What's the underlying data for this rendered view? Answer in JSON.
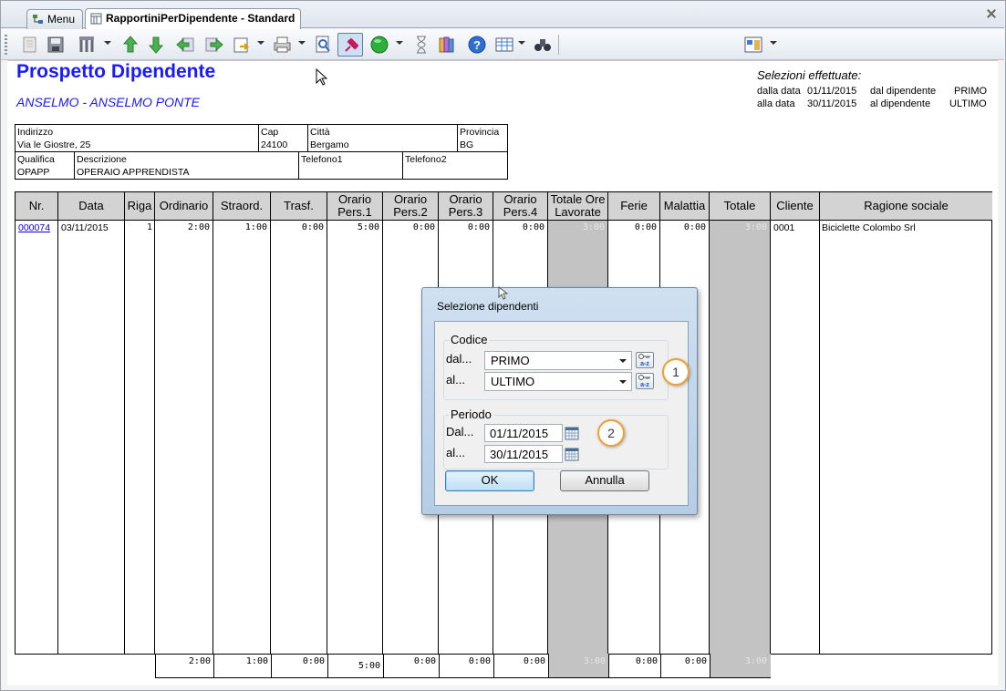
{
  "tabs": [
    {
      "label": "Menu"
    },
    {
      "label": "RapportiniPerDipendente - Standard"
    }
  ],
  "report": {
    "title": "Prospetto Dipendente",
    "subtitle": "ANSELMO  -  ANSELMO PONTE",
    "selections": {
      "heading": "Selezioni effettuate:",
      "from_date_label": "dalla data",
      "from_date": "01/11/2015",
      "to_date_label": "alla data",
      "to_date": "30/11/2015",
      "from_emp_label": "dal dipendente",
      "from_emp": "PRIMO",
      "to_emp_label": "al dipendente",
      "to_emp": "ULTIMO"
    },
    "info": {
      "indirizzo_label": "Indirizzo",
      "indirizzo": "Via le Giostre, 25",
      "cap_label": "Cap",
      "cap": "24100",
      "citta_label": "Città",
      "citta": "Bergamo",
      "provincia_label": "Provincia",
      "provincia": "BG",
      "qualifica_label": "Qualifica",
      "qualifica": "OPAPP",
      "descrizione_label": "Descrizione",
      "descrizione": "OPERAIO APPRENDISTA",
      "telefono1_label": "Telefono1",
      "telefono1": "",
      "telefono2_label": "Telefono2",
      "telefono2": ""
    },
    "columns": [
      "Nr.",
      "Data",
      "Riga",
      "Ordinario",
      "Straord.",
      "Trasf.",
      "Orario Pers.1",
      "Orario Pers.2",
      "Orario Pers.3",
      "Orario Pers.4",
      "Totale Ore Lavorate",
      "Ferie",
      "Malattia",
      "Totale",
      "Cliente",
      "Ragione sociale"
    ],
    "row": {
      "nr": "000074",
      "data": "03/11/2015",
      "riga": "1",
      "ordinario": "2:00",
      "straord": "1:00",
      "trasf": "0:00",
      "pers1": "5:00",
      "pers2": "0:00",
      "pers3": "0:00",
      "pers4": "0:00",
      "totale_ore": "3:00",
      "ferie": "0:00",
      "malattia": "0:00",
      "totale": "3:00",
      "cliente": "0001",
      "ragione": "Biciclette Colombo Srl"
    },
    "totals": {
      "ordinario": "2:00",
      "straord": "1:00",
      "trasf": "0:00",
      "pers1": "5:00",
      "pers2": "0:00",
      "pers3": "0:00",
      "pers4": "0:00",
      "totale_ore": "3:00",
      "ferie": "0:00",
      "malattia": "0:00",
      "totale": "3:00"
    }
  },
  "dialog": {
    "title": "Selezione dipendenti",
    "codice_group": "Codice",
    "dal_label": "dal...",
    "dal_value": "PRIMO",
    "al_label": "al...",
    "al_value": "ULTIMO",
    "periodo_group": "Periodo",
    "dal_date_label": "Dal...",
    "dal_date": "01/11/2015",
    "al_date_label": "al...",
    "al_date": "30/11/2015",
    "ok_label": "OK",
    "cancel_label": "Annulla",
    "callout1": "1",
    "callout2": "2"
  }
}
